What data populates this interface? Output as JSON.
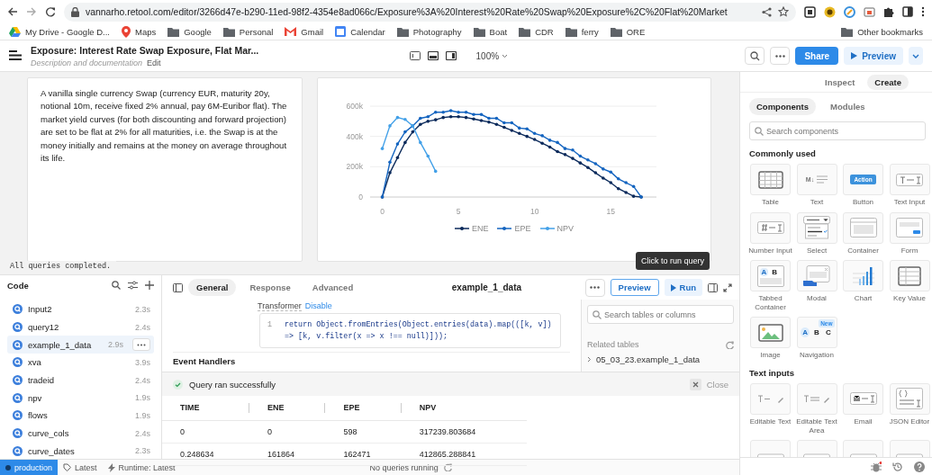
{
  "browser": {
    "url": "vannarho.retool.com/editor/3266d47e-b290-11ed-98f2-4354e8ad066c/Exposure%3A%20Interest%20Rate%20Swap%20Exposure%2C%20Flat%20Market",
    "bookmarks": [
      {
        "label": "My Drive - Google D...",
        "kind": "drive"
      },
      {
        "label": "Maps",
        "kind": "maps"
      },
      {
        "label": "Google",
        "kind": "folder"
      },
      {
        "label": "Personal",
        "kind": "folder"
      },
      {
        "label": "Gmail",
        "kind": "gmail"
      },
      {
        "label": "Calendar",
        "kind": "calendar"
      },
      {
        "label": "Photography",
        "kind": "folder"
      },
      {
        "label": "Boat",
        "kind": "folder"
      },
      {
        "label": "CDR",
        "kind": "folder"
      },
      {
        "label": "ferry",
        "kind": "folder"
      },
      {
        "label": "ORE",
        "kind": "folder"
      }
    ],
    "other_bookmarks": "Other bookmarks"
  },
  "app_header": {
    "title": "Exposure: Interest Rate Swap Exposure, Flat Mar...",
    "subtitle": "Description and documentation",
    "edit_link": "Edit",
    "zoom": "100%",
    "share_button": "Share",
    "preview_button": "Preview"
  },
  "canvas": {
    "description": "A vanilla single currency Swap (currency EUR, maturity 20y, notional 10m, receive fixed 2% annual, pay 6M-Euribor flat). The market yield curves (for both discounting and forward projection) are set to be flat at 2% for all maturities, i.e. the Swap is at the money initially and remains at the money on average throughout its life.",
    "chart": {
      "chart_data": {
        "type": "line",
        "x": [
          0,
          0.5,
          1,
          1.5,
          2,
          2.5,
          3,
          3.5,
          4,
          4.5,
          5,
          5.5,
          6,
          6.5,
          7,
          7.5,
          8,
          8.5,
          9,
          9.5,
          10,
          10.5,
          11,
          11.5,
          12,
          12.5,
          13,
          13.5,
          14,
          14.5,
          15,
          15.5,
          16,
          16.5,
          17
        ],
        "series": [
          {
            "name": "ENE",
            "color": "#0b2a5b",
            "values": [
              0,
              160000,
              260000,
              360000,
              430000,
              480000,
              500000,
              510000,
              525000,
              530000,
              530000,
              525000,
              515000,
              505000,
              495000,
              480000,
              460000,
              440000,
              420000,
              400000,
              380000,
              355000,
              330000,
              300000,
              280000,
              255000,
              225000,
              195000,
              160000,
              125000,
              95000,
              55000,
              30000,
              5000,
              0
            ]
          },
          {
            "name": "EPE",
            "color": "#1565c0",
            "values": [
              0,
              230000,
              350000,
              430000,
              470000,
              520000,
              530000,
              560000,
              560000,
              570000,
              560000,
              560000,
              545000,
              545000,
              520000,
              520000,
              490000,
              490000,
              455000,
              450000,
              420000,
              405000,
              375000,
              360000,
              320000,
              310000,
              270000,
              245000,
              220000,
              185000,
              165000,
              120000,
              95000,
              70000,
              0
            ]
          },
          {
            "name": "NPV",
            "color": "#42a0e8",
            "values": [
              320000,
              470000,
              525000,
              512000,
              470000,
              360000,
              270000,
              170000,
              null,
              null,
              null,
              null,
              null,
              null,
              null,
              null,
              null,
              null,
              null,
              null,
              null,
              null,
              null,
              null,
              null,
              null,
              null,
              null,
              null,
              null,
              null,
              null,
              null,
              null,
              null
            ]
          }
        ],
        "xlim": [
          -0.8,
          18
        ],
        "ylim": [
          0,
          600000
        ],
        "xticks": [
          0,
          5,
          10,
          15
        ],
        "yticks": [
          {
            "value": 0,
            "label": "0"
          },
          {
            "value": 200000,
            "label": "200k"
          },
          {
            "value": 400000,
            "label": "400k"
          },
          {
            "value": 600000,
            "label": "600k"
          }
        ]
      }
    },
    "status_message": "All queries completed.",
    "tooltip": "Click to run query"
  },
  "code_panel": {
    "title": "Code",
    "queries": [
      {
        "name": "Input2",
        "time": "2.3s",
        "selected": false
      },
      {
        "name": "query12",
        "time": "2.4s",
        "selected": false
      },
      {
        "name": "example_1_data",
        "time": "2.9s",
        "selected": true
      },
      {
        "name": "xva",
        "time": "3.9s",
        "selected": false
      },
      {
        "name": "tradeid",
        "time": "2.4s",
        "selected": false
      },
      {
        "name": "npv",
        "time": "1.9s",
        "selected": false
      },
      {
        "name": "flows",
        "time": "1.9s",
        "selected": false
      },
      {
        "name": "curve_cols",
        "time": "2.4s",
        "selected": false
      },
      {
        "name": "curve_dates",
        "time": "2.3s",
        "selected": false
      }
    ]
  },
  "query_editor": {
    "tabs": [
      {
        "label": "General",
        "selected": true
      },
      {
        "label": "Response",
        "selected": false
      },
      {
        "label": "Advanced",
        "selected": false
      }
    ],
    "query_name": "example_1_data",
    "preview_button": "Preview",
    "run_button": "Run",
    "transformer_label": "Transformer",
    "transformer_toggle": "Disable",
    "code_line_number": "1",
    "code": "return Object.fromEntries(Object.entries(data).map(([k, v]) => [k, v.filter(x => x !== null)]));",
    "event_handlers": "Event Handlers",
    "schema": {
      "search_placeholder": "Search tables or columns",
      "related_tables_label": "Related tables",
      "tables": [
        "05_03_23.example_1_data"
      ]
    },
    "results": {
      "message": "Query ran successfully",
      "close": "Close",
      "columns": [
        "TIME",
        "ENE",
        "EPE",
        "NPV"
      ],
      "rows": [
        [
          "0",
          "0",
          "598",
          "317239.803684"
        ],
        [
          "0.248634",
          "161864",
          "162471",
          "412865.288841"
        ]
      ]
    }
  },
  "right_panel": {
    "tabs": [
      {
        "label": "Inspect",
        "selected": false
      },
      {
        "label": "Create",
        "selected": true
      }
    ],
    "subtabs": [
      {
        "label": "Components",
        "selected": true
      },
      {
        "label": "Modules",
        "selected": false
      }
    ],
    "search_placeholder": "Search components",
    "sections": [
      {
        "title": "Commonly used",
        "items": [
          {
            "label": "Table",
            "kind": "table"
          },
          {
            "label": "Text",
            "kind": "text",
            "icon_text": [
              "M↓"
            ]
          },
          {
            "label": "Button",
            "kind": "button",
            "icon_text": [
              "Action"
            ]
          },
          {
            "label": "Text Input",
            "kind": "text-input"
          },
          {
            "label": "Number Input",
            "kind": "number-input"
          },
          {
            "label": "Select",
            "kind": "select"
          },
          {
            "label": "Container",
            "kind": "container"
          },
          {
            "label": "Form",
            "kind": "form"
          },
          {
            "label": "Tabbed Container",
            "kind": "tabbed-container",
            "icon_text": [
              "A",
              "B"
            ]
          },
          {
            "label": "Modal",
            "kind": "modal"
          },
          {
            "label": "Chart",
            "kind": "chart"
          },
          {
            "label": "Key Value",
            "kind": "key-value"
          },
          {
            "label": "Image",
            "kind": "image"
          },
          {
            "label": "Navigation",
            "kind": "navigation",
            "icon_text": [
              "A",
              "B",
              "C"
            ],
            "badge": "New"
          }
        ]
      },
      {
        "title": "Text inputs",
        "items": [
          {
            "label": "Editable Text",
            "kind": "editable-text"
          },
          {
            "label": "Editable Text Area",
            "kind": "editable-text-area"
          },
          {
            "label": "Email",
            "kind": "email"
          },
          {
            "label": "JSON Editor",
            "kind": "json-editor"
          },
          {
            "kind": "generic"
          },
          {
            "kind": "generic"
          },
          {
            "kind": "generic"
          },
          {
            "kind": "generic"
          }
        ]
      }
    ]
  },
  "status_bar": {
    "environment": "production",
    "version": "Latest",
    "runtime": "Runtime: Latest",
    "queries": "No queries running"
  }
}
